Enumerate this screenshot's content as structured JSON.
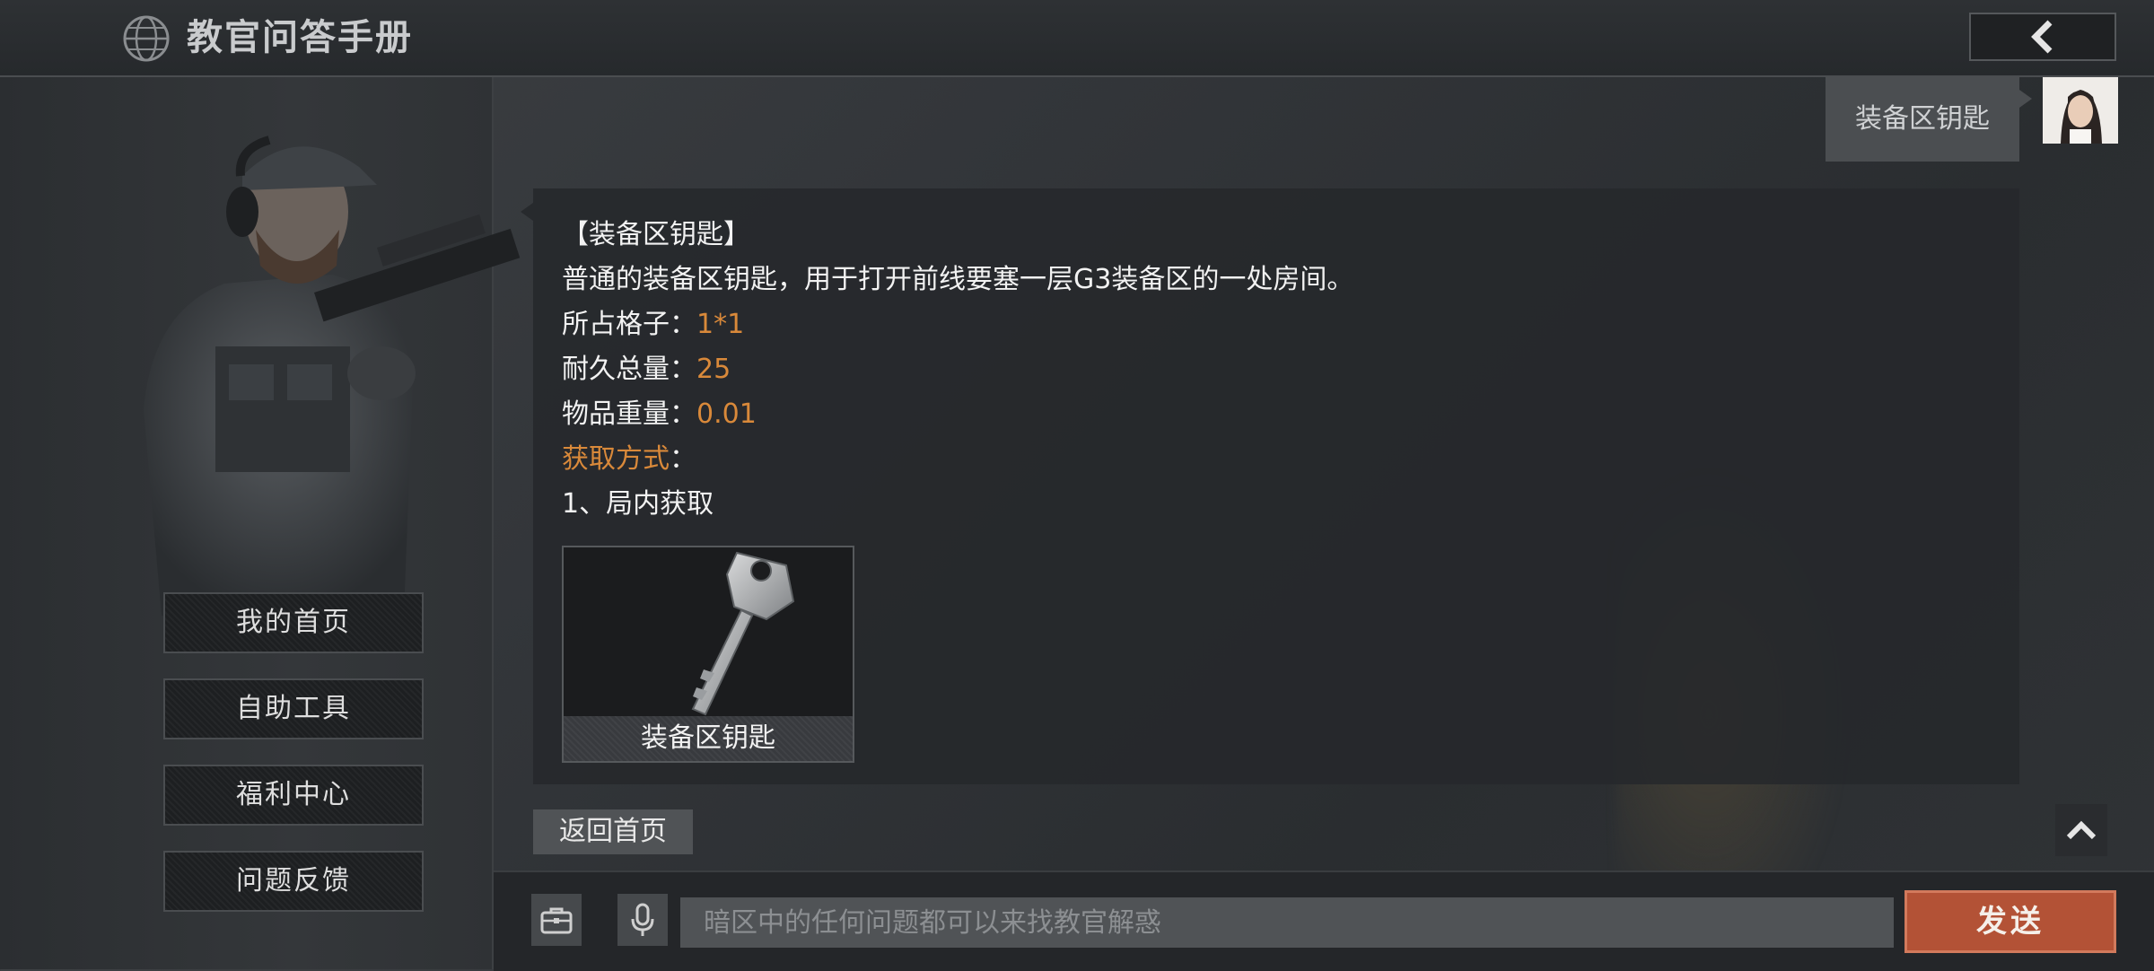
{
  "header": {
    "title": "教官问答手册",
    "globe_icon": "globe-icon",
    "back_icon": "chevron-left-icon"
  },
  "sidebar": {
    "items": [
      {
        "label": "我的首页"
      },
      {
        "label": "自助工具"
      },
      {
        "label": "福利中心"
      },
      {
        "label": "问题反馈"
      }
    ]
  },
  "chat": {
    "user_message": "装备区钥匙",
    "answer": {
      "title": "【装备区钥匙】",
      "description": "普通的装备区钥匙，用于打开前线要塞一层G3装备区的一处房间。",
      "slots_label": "所占格子：",
      "slots_value": "1*1",
      "durability_label": "耐久总量：",
      "durability_value": "25",
      "weight_label": "物品重量：",
      "weight_value": "0.01",
      "source_label": "获取方式",
      "source_colon": "：",
      "source_item": "1、局内获取",
      "item_name": "装备区钥匙"
    },
    "home_link": "返回首页",
    "scroll_top_icon": "chevron-up-icon"
  },
  "input_bar": {
    "placeholder": "暗区中的任何问题都可以来找教官解惑",
    "send_label": "发送",
    "toolbox_icon": "toolbox-icon",
    "mic_icon": "microphone-icon"
  },
  "colors": {
    "accent_orange": "#d9893a",
    "send_button": "#b35236"
  }
}
